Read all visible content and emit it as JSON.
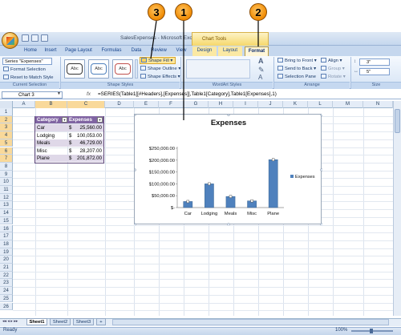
{
  "app": {
    "window_title": "SalesExpenses - Microsoft Excel",
    "contextual_group": "Chart Tools",
    "tabs": [
      "Home",
      "Insert",
      "Page Layout",
      "Formulas",
      "Data",
      "Review",
      "View",
      "Design",
      "Layout",
      "Format"
    ],
    "active_tab": "Format"
  },
  "ribbon": {
    "current_selection": {
      "dropdown_value": "Series \"Expenses\"",
      "format_selection": "Format Selection",
      "reset_to_match_style": "Reset to Match Style",
      "group_label": "Current Selection"
    },
    "shape_styles": {
      "sample_labels": [
        "Abc",
        "Abc",
        "Abc"
      ],
      "shape_fill": "Shape Fill",
      "shape_outline": "Shape Outline",
      "shape_effects": "Shape Effects",
      "group_label": "Shape Styles"
    },
    "wordart_styles": {
      "letter": "A",
      "group_label": "WordArt Styles"
    },
    "arrange": {
      "bring_to_front": "Bring to Front",
      "send_to_back": "Send to Back",
      "selection_pane": "Selection Pane",
      "align": "Align",
      "group": "Group",
      "rotate": "Rotate",
      "group_label": "Arrange"
    },
    "size": {
      "height": "3\"",
      "width": "5\"",
      "group_label": "Size"
    }
  },
  "formula_bar": {
    "name_box": "Chart 3",
    "fx": "fx",
    "formula": "=SERIES(Table1[[#Headers],[Expenses]],Table1[Category],Table1[Expenses],1)"
  },
  "columns": [
    "A",
    "B",
    "C",
    "D",
    "E",
    "F",
    "G",
    "H",
    "I",
    "J",
    "K",
    "L",
    "M",
    "N"
  ],
  "rows": [
    "1",
    "2",
    "3",
    "4",
    "5",
    "6",
    "7",
    "8",
    "9",
    "10",
    "11",
    "12",
    "13",
    "14",
    "15",
    "16",
    "17",
    "18",
    "19",
    "20",
    "21",
    "22",
    "23",
    "24",
    "25",
    "26"
  ],
  "table": {
    "headers": [
      "Category",
      "Expenses"
    ],
    "rows": [
      {
        "category": "Car",
        "currency": "$",
        "amount": "25,560.00"
      },
      {
        "category": "Lodging",
        "currency": "$",
        "amount": "100,053.00"
      },
      {
        "category": "Meals",
        "currency": "$",
        "amount": "46,729.00"
      },
      {
        "category": "Misc",
        "currency": "$",
        "amount": "28,207.00"
      },
      {
        "category": "Plane",
        "currency": "$",
        "amount": "201,872.00"
      }
    ]
  },
  "chart_data": {
    "type": "bar",
    "title": "Expenses",
    "categories": [
      "Car",
      "Lodging",
      "Meals",
      "Misc",
      "Plane"
    ],
    "series": [
      {
        "name": "Expenses",
        "values": [
          25560,
          100053,
          46729,
          28207,
          201872
        ]
      }
    ],
    "ylim": [
      0,
      250000
    ],
    "yticks": [
      "$-",
      "$50,000.00",
      "$100,000.00",
      "$150,000.00",
      "$200,000.00",
      "$250,000.00"
    ],
    "legend": "right",
    "grid": false,
    "colors": {
      "bar": "#4f81bd"
    }
  },
  "sheets": {
    "tabs": [
      "Sheet1",
      "Sheet2",
      "Sheet3"
    ],
    "active": "Sheet1"
  },
  "status": {
    "mode": "Ready",
    "zoom": "100%"
  },
  "callouts": [
    "3",
    "1",
    "2"
  ]
}
